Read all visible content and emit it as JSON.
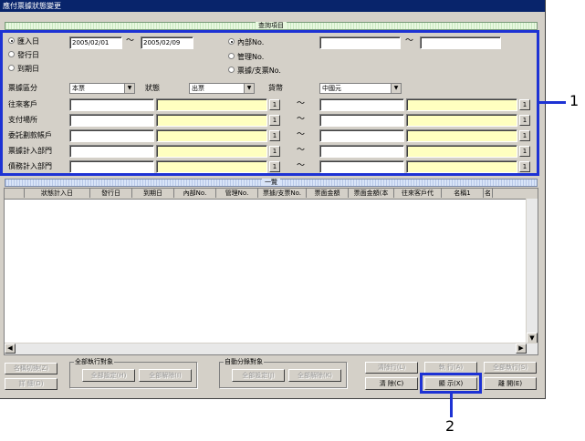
{
  "window": {
    "title": "應付票據狀態變更"
  },
  "query": {
    "section_title": "查詢項目",
    "date_radios": [
      {
        "label": "匯入日",
        "checked": true
      },
      {
        "label": "發行日",
        "checked": false
      },
      {
        "label": "到期日",
        "checked": false
      }
    ],
    "date_from": "2005/02/01",
    "date_to": "2005/02/09",
    "tilde": "～",
    "no_radios": [
      {
        "label": "內部No.",
        "checked": true
      },
      {
        "label": "管理No.",
        "checked": false
      },
      {
        "label": "票據/支票No.",
        "checked": false
      }
    ],
    "no_from": "",
    "no_to": "",
    "bill_type_label": "票據區分",
    "bill_type_value": "本票",
    "status_label": "狀態",
    "status_value": "出票",
    "currency_label": "貨幣",
    "currency_value": "中國元",
    "range_rows": [
      {
        "label": "往來客戶"
      },
      {
        "label": "支付場所"
      },
      {
        "label": "委託劃款帳戶"
      },
      {
        "label": "票據計入部門"
      },
      {
        "label": "債務計入部門"
      }
    ],
    "lookup_btn": "1"
  },
  "list": {
    "section_title": "一覽",
    "columns": [
      "狀態計入日",
      "發行日",
      "到期日",
      "內部No.",
      "管理No.",
      "票據/支票No.",
      "票面金額",
      "票面金額(本",
      "往來客戶代",
      "名稱1",
      "名"
    ]
  },
  "bottom": {
    "name_switch": "名稱切換(Z)",
    "detail": "詳 細(D)",
    "all_exec_group": "全部執行對象",
    "all_set": "全部設定(H)",
    "all_clear": "全部解除(I)",
    "auto_group": "自動分錄對象",
    "auto_set": "全部設定(J)",
    "auto_clear": "全部解除(K)",
    "clear_row": "清除行(L)",
    "exec": "執 行(A)",
    "exec_all": "全部執行(S)",
    "clear": "清 除(C)",
    "show": "顯 示(X)",
    "close": "離 開(E)"
  },
  "callouts": {
    "one": "1",
    "two": "2"
  },
  "colors": {
    "highlight": "#1d32d4",
    "title_bar": "#08246b",
    "yellow_field": "#ffffc0"
  }
}
